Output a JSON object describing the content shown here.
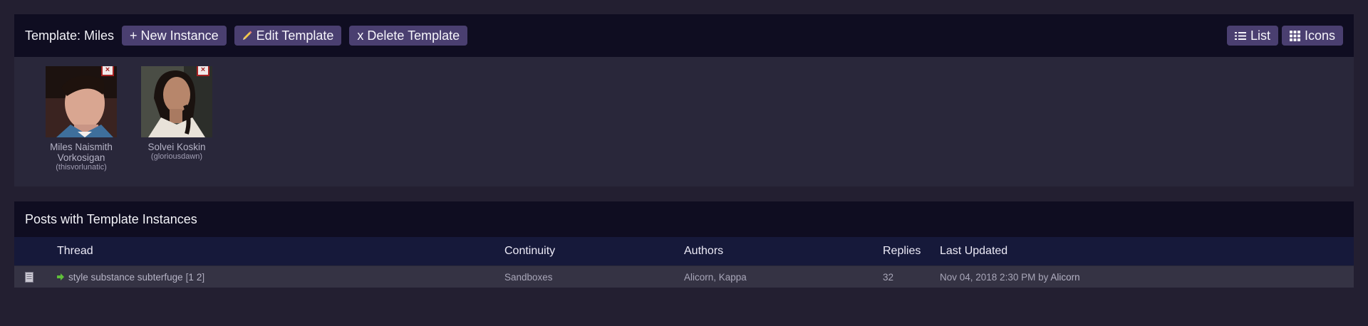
{
  "template": {
    "title": "Template: Miles",
    "buttons": {
      "new_instance": "+ New Instance",
      "edit_template": "Edit Template",
      "delete_template": "x Delete Template"
    },
    "view_toggle": {
      "list": "List",
      "icons": "Icons"
    },
    "characters": [
      {
        "name": "Miles Naismith Vorkosigan",
        "user": "(thisvorlunatic)",
        "remove": "×"
      },
      {
        "name": "Solvei Koskin",
        "user": "(gloriousdawn)",
        "remove": "×"
      }
    ]
  },
  "posts": {
    "title": "Posts with Template Instances",
    "columns": {
      "thread": "Thread",
      "continuity": "Continuity",
      "authors": "Authors",
      "replies": "Replies",
      "last_updated": "Last Updated"
    },
    "rows": [
      {
        "thread": "style substance subterfuge",
        "pages_open": "[",
        "page1": "1",
        "page2": "2",
        "pages_close": "]",
        "continuity": "Sandboxes",
        "authors": "Alicorn, Kappa",
        "replies": "32",
        "last_updated": "Nov 04, 2018 2:30 PM",
        "by": "by",
        "last_author": "Alicorn"
      }
    ]
  },
  "colors": {
    "background": "#231f31",
    "header": "#0f0d21",
    "button": "#4a3f70",
    "table_header": "#16193a",
    "row": "#353344",
    "remove_border": "#a52121"
  },
  "icons": {
    "edit": "pencil-icon",
    "list": "list-icon",
    "icons": "grid-icon",
    "row_status": "document-icon",
    "row_arrow": "arrow-right-icon"
  }
}
